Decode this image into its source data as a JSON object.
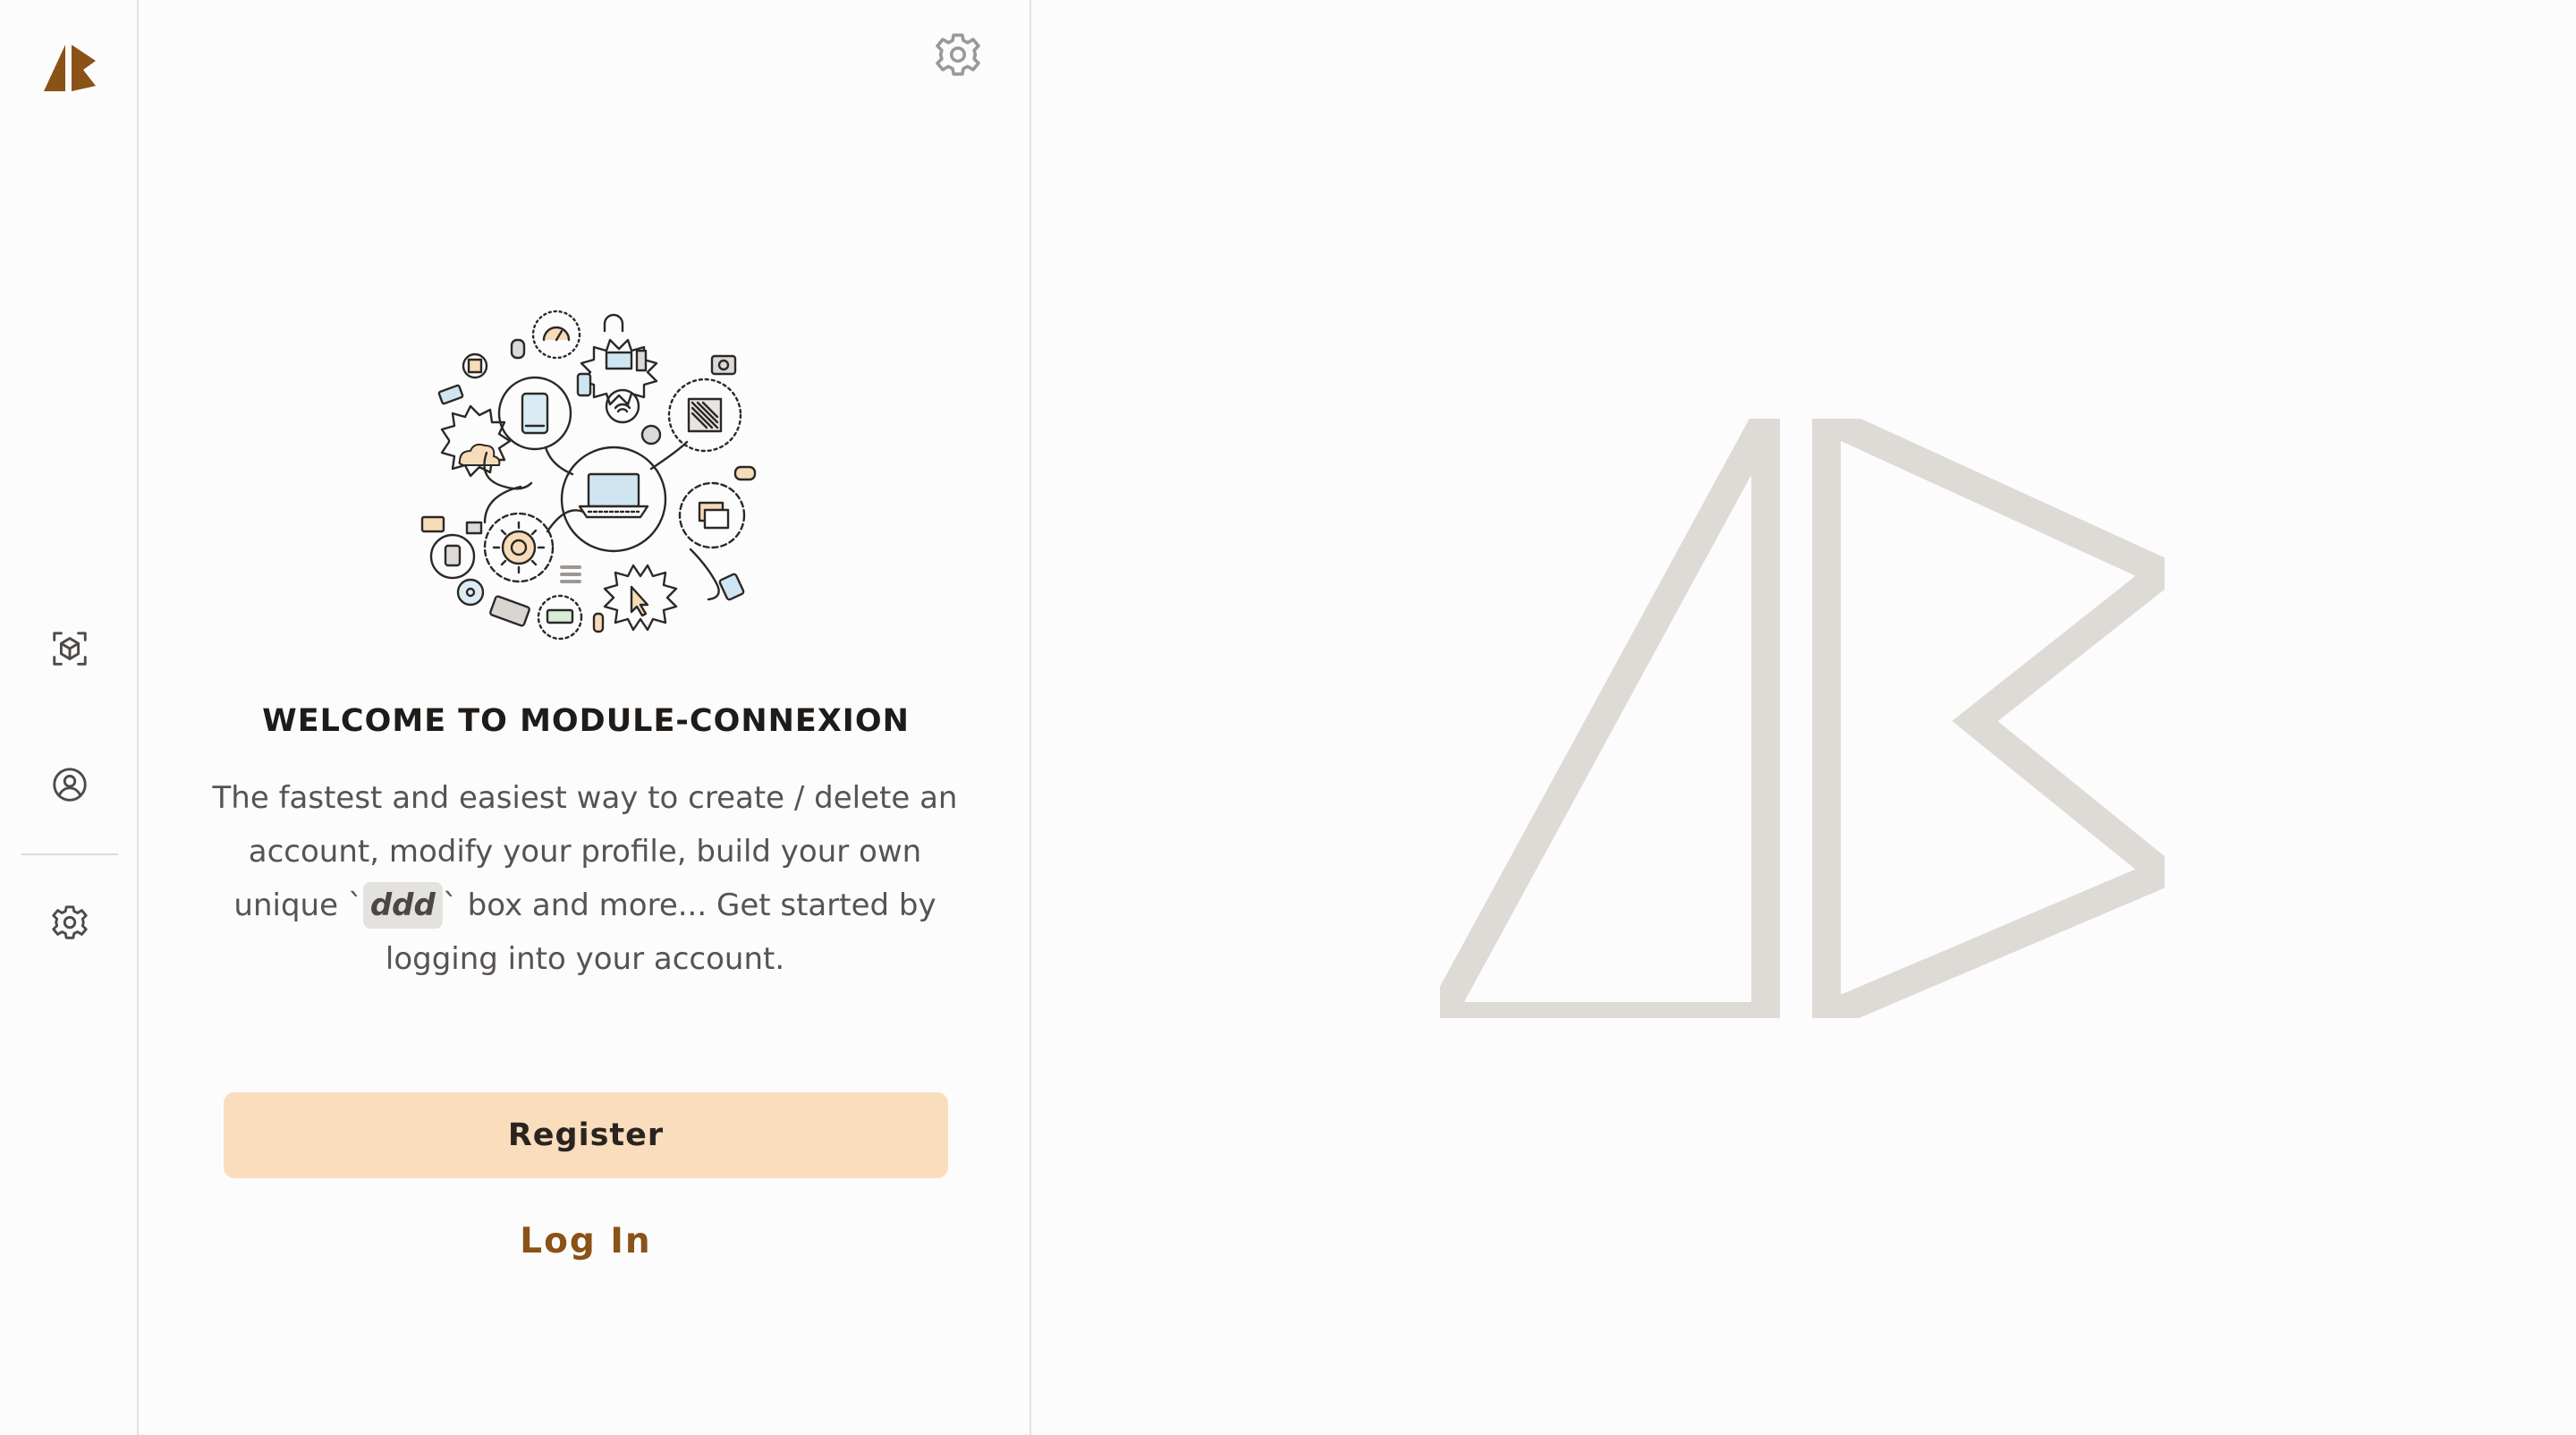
{
  "app": {
    "brand_color": "#8a5216",
    "accent_color": "#f9ddbd"
  },
  "rail": {
    "logo": "app-logo",
    "items": [
      {
        "icon": "cube-scan-icon"
      },
      {
        "icon": "user-circle-icon"
      },
      {
        "icon": "gear-icon"
      }
    ]
  },
  "welcome": {
    "title": "WELCOME TO MODULE-CONNEXION",
    "desc_before": "The fastest and easiest way to create / delete an account, modify your profile, build your own unique",
    "backtick_open": "`",
    "code": "ddd",
    "backtick_close": "`",
    "desc_after": "box and more... Get started by logging into your account.",
    "register_label": "Register",
    "login_label": "Log In",
    "illustration": "devices-illustration",
    "settings_icon": "gear-icon"
  },
  "stage": {
    "watermark": "app-logo-watermark",
    "watermark_color": "#dedad6"
  }
}
